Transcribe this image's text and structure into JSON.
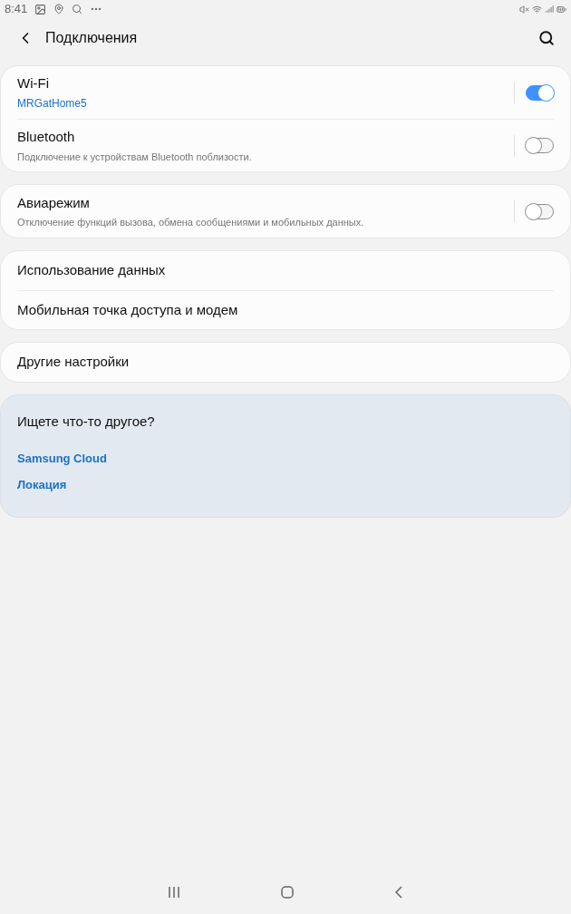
{
  "status_bar": {
    "time": "8:41"
  },
  "header": {
    "title": "Подключения"
  },
  "groups": [
    {
      "items": [
        {
          "kind": "toggle",
          "title": "Wi-Fi",
          "subtitle": "MRGatHome5",
          "subtitle_accent": true,
          "on": true
        },
        {
          "kind": "toggle",
          "title": "Bluetooth",
          "subtitle": "Подключение к устройствам Bluetooth поблизости.",
          "subtitle_accent": false,
          "on": false
        }
      ]
    },
    {
      "items": [
        {
          "kind": "toggle",
          "title": "Авиарежим",
          "subtitle": "Отключение функций вызова, обмена сообщениями и мобильных данных.",
          "subtitle_accent": false,
          "on": false
        }
      ]
    },
    {
      "items": [
        {
          "kind": "plain",
          "title": "Использование данных"
        },
        {
          "kind": "plain",
          "title": "Мобильная точка доступа и модем"
        }
      ]
    },
    {
      "items": [
        {
          "kind": "plain",
          "title": "Другие настройки"
        }
      ]
    }
  ],
  "suggestions": {
    "title": "Ищете что-то другое?",
    "links": [
      "Samsung Cloud",
      "Локация"
    ]
  }
}
